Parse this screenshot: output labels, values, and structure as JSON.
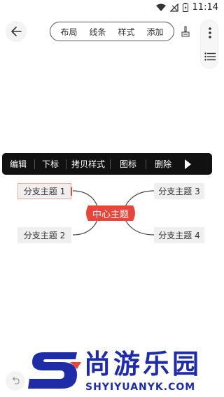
{
  "status_bar": {
    "time": "11:14"
  },
  "toolbar": {
    "tabs": [
      "布局",
      "线条",
      "样式",
      "添加"
    ]
  },
  "context_menu": {
    "items": [
      "编辑",
      "下标",
      "拷贝样式",
      "图标",
      "删除"
    ]
  },
  "mindmap": {
    "central": "中心主题",
    "branches": [
      "分支主题 1",
      "分支主题 2",
      "分支主题 3",
      "分支主题 4"
    ],
    "selected_branch": "分支主题 1"
  },
  "watermark": {
    "text": "尚游乐园",
    "subtext": "SHYIYUANYK.COM"
  },
  "colors": {
    "accent_red": "#e8453c",
    "node_gray": "#efefef",
    "watermark_blue": "#1f2ca8"
  }
}
